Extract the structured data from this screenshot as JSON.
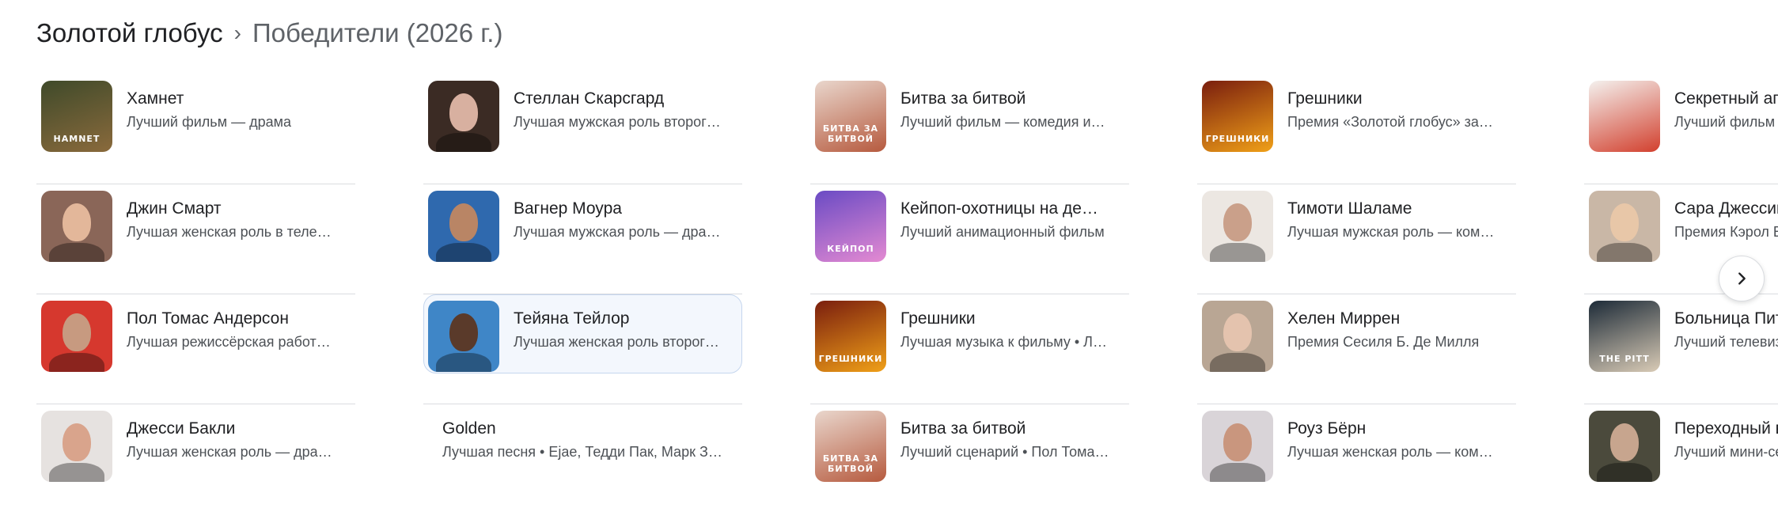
{
  "breadcrumb": {
    "root": "Золотой глобус",
    "separator": "›",
    "current": "Победители (2026 г.)"
  },
  "next_button": {
    "icon": "chevron-right-icon"
  },
  "columns": [
    [
      {
        "title": "Хамнет",
        "subtitle": "Лучший фильм — драма",
        "thumb": "poster",
        "bg": "#3f4a2a",
        "accent": "#8a6a3c",
        "poster_text": "HAMNET"
      },
      {
        "title": "Джин Смарт",
        "subtitle": "Лучшая женская роль в теле…",
        "thumb": "person",
        "bg": "#8a6658",
        "accent": "#e3b79a"
      },
      {
        "title": "Пол Томас Андерсон",
        "subtitle": "Лучшая режиссёрская работ…",
        "thumb": "person",
        "bg": "#d6382e",
        "accent": "#c79a80"
      },
      {
        "title": "Джесси Бакли",
        "subtitle": "Лучшая женская роль — дра…",
        "thumb": "person",
        "bg": "#e6e2e0",
        "accent": "#d9a48c"
      }
    ],
    [
      {
        "title": "Стеллан Скарсгард",
        "subtitle": "Лучшая мужская роль второг…",
        "thumb": "person",
        "bg": "#3b2b24",
        "accent": "#d8b0a0"
      },
      {
        "title": "Вагнер Моура",
        "subtitle": "Лучшая мужская роль — дра…",
        "thumb": "person",
        "bg": "#2f69ae",
        "accent": "#b98565"
      },
      {
        "title": "Тейяна Тейлор",
        "subtitle": "Лучшая женская роль второг…",
        "thumb": "person",
        "bg": "#3f86c7",
        "accent": "#5a3a2a",
        "selected": true
      },
      {
        "title": "Golden",
        "subtitle": "Лучшая песня • Ejae, Тедди Пак, Марк З…",
        "thumb": "none"
      }
    ],
    [
      {
        "title": "Битва за битвой",
        "subtitle": "Лучший фильм — комедия и…",
        "thumb": "poster",
        "bg": "#e9d6cc",
        "accent": "#b65a3e",
        "poster_text": "БИТВА ЗА БИТВОЙ"
      },
      {
        "title": "Кейпоп-охотницы на де…",
        "subtitle": "Лучший анимационный фильм",
        "thumb": "poster",
        "bg": "#6a4bc4",
        "accent": "#e48ad2",
        "poster_text": "КЕЙПОП"
      },
      {
        "title": "Грешники",
        "subtitle": "Лучшая музыка к фильму • Л…",
        "thumb": "poster",
        "bg": "#7a1e0e",
        "accent": "#f0a018",
        "poster_text": "ГРЕШНИКИ"
      },
      {
        "title": "Битва за битвой",
        "subtitle": "Лучший сценарий • Пол Тома…",
        "thumb": "poster",
        "bg": "#e9d6cc",
        "accent": "#b65a3e",
        "poster_text": "БИТВА ЗА БИТВОЙ"
      }
    ],
    [
      {
        "title": "Грешники",
        "subtitle": "Премия «Золотой глобус» за…",
        "thumb": "poster",
        "bg": "#7a1e0e",
        "accent": "#f0a018",
        "poster_text": "ГРЕШНИКИ"
      },
      {
        "title": "Тимоти Шаламе",
        "subtitle": "Лучшая мужская роль — ком…",
        "thumb": "person",
        "bg": "#ece7e2",
        "accent": "#caa08a"
      },
      {
        "title": "Хелен Миррен",
        "subtitle": "Премия Сесиля Б. Де Милля",
        "thumb": "person",
        "bg": "#b9a694",
        "accent": "#e4c3ae"
      },
      {
        "title": "Роуз Бёрн",
        "subtitle": "Лучшая женская роль — ком…",
        "thumb": "person",
        "bg": "#d9d4d8",
        "accent": "#c9967e"
      }
    ],
    [
      {
        "title": "Секретный агент",
        "subtitle": "Лучший фильм на иностранном языке",
        "thumb": "poster",
        "bg": "#f4f1ee",
        "accent": "#d2402e",
        "poster_text": ""
      },
      {
        "title": "Сара Джессика Паркер",
        "subtitle": "Премия Кэрол Бёрнетт",
        "thumb": "person",
        "bg": "#c9b7a6",
        "accent": "#e8c7a8"
      },
      {
        "title": "Больница Питт",
        "subtitle": "Лучший телевизионный сериал — драма",
        "thumb": "poster",
        "bg": "#1d2b38",
        "accent": "#d9cbb6",
        "poster_text": "THE PITT"
      },
      {
        "title": "Переходный возраст",
        "subtitle": "Лучший мини-сериал",
        "thumb": "person",
        "bg": "#4b4a3c",
        "accent": "#c7a58e"
      }
    ]
  ]
}
